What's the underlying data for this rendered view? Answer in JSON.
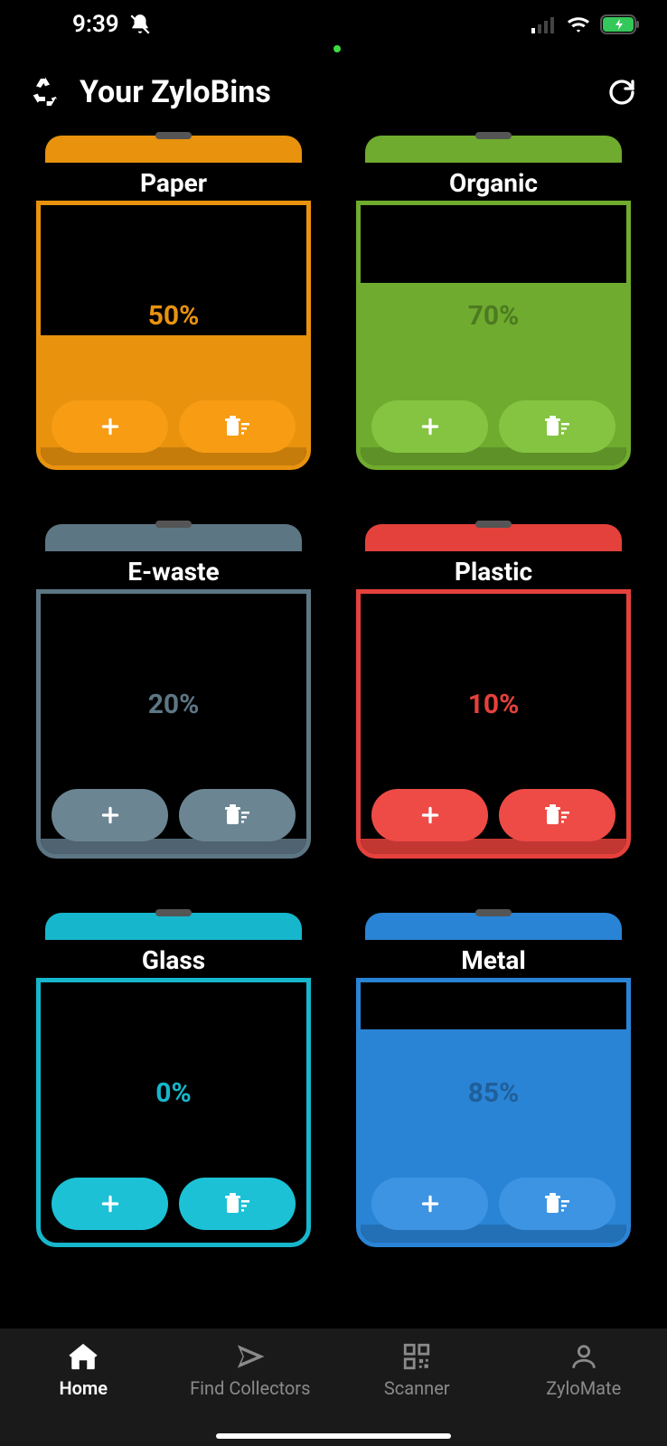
{
  "status": {
    "time": "9:39"
  },
  "header": {
    "title": "Your ZyloBins"
  },
  "bins": [
    {
      "label": "Paper",
      "percent": "50%",
      "color": "#e8920e",
      "btn": "#f79c13",
      "btn_icon": "#ffffff",
      "percent_color": "#e8920e",
      "fill_pct": 50
    },
    {
      "label": "Organic",
      "percent": "70%",
      "color": "#6fab2e",
      "btn": "#84c441",
      "btn_icon": "#ffffff",
      "percent_color": "#4d7a21",
      "fill_pct": 70
    },
    {
      "label": "E-waste",
      "percent": "20%",
      "color": "#5d7684",
      "btn": "#6b8593",
      "btn_icon": "#ffffff",
      "percent_color": "#5d7684",
      "fill_pct": 6
    },
    {
      "label": "Plastic",
      "percent": "10%",
      "color": "#e5413c",
      "btn": "#ee4b46",
      "btn_icon": "#ffffff",
      "percent_color": "#e5413c",
      "fill_pct": 6
    },
    {
      "label": "Glass",
      "percent": "0%",
      "color": "#16b7cc",
      "btn": "#1cc1d6",
      "btn_icon": "#ffffff",
      "percent_color": "#16b7cc",
      "fill_pct": 0
    },
    {
      "label": "Metal",
      "percent": "85%",
      "color": "#2a84d6",
      "btn": "#3d94e2",
      "btn_icon": "#ffffff",
      "percent_color": "#1f5f9a",
      "fill_pct": 82
    }
  ],
  "tabs": [
    {
      "label": "Home",
      "icon": "home",
      "active": true
    },
    {
      "label": "Find Collectors",
      "icon": "send",
      "active": false
    },
    {
      "label": "Scanner",
      "icon": "qr",
      "active": false
    },
    {
      "label": "ZyloMate",
      "icon": "person",
      "active": false
    }
  ]
}
